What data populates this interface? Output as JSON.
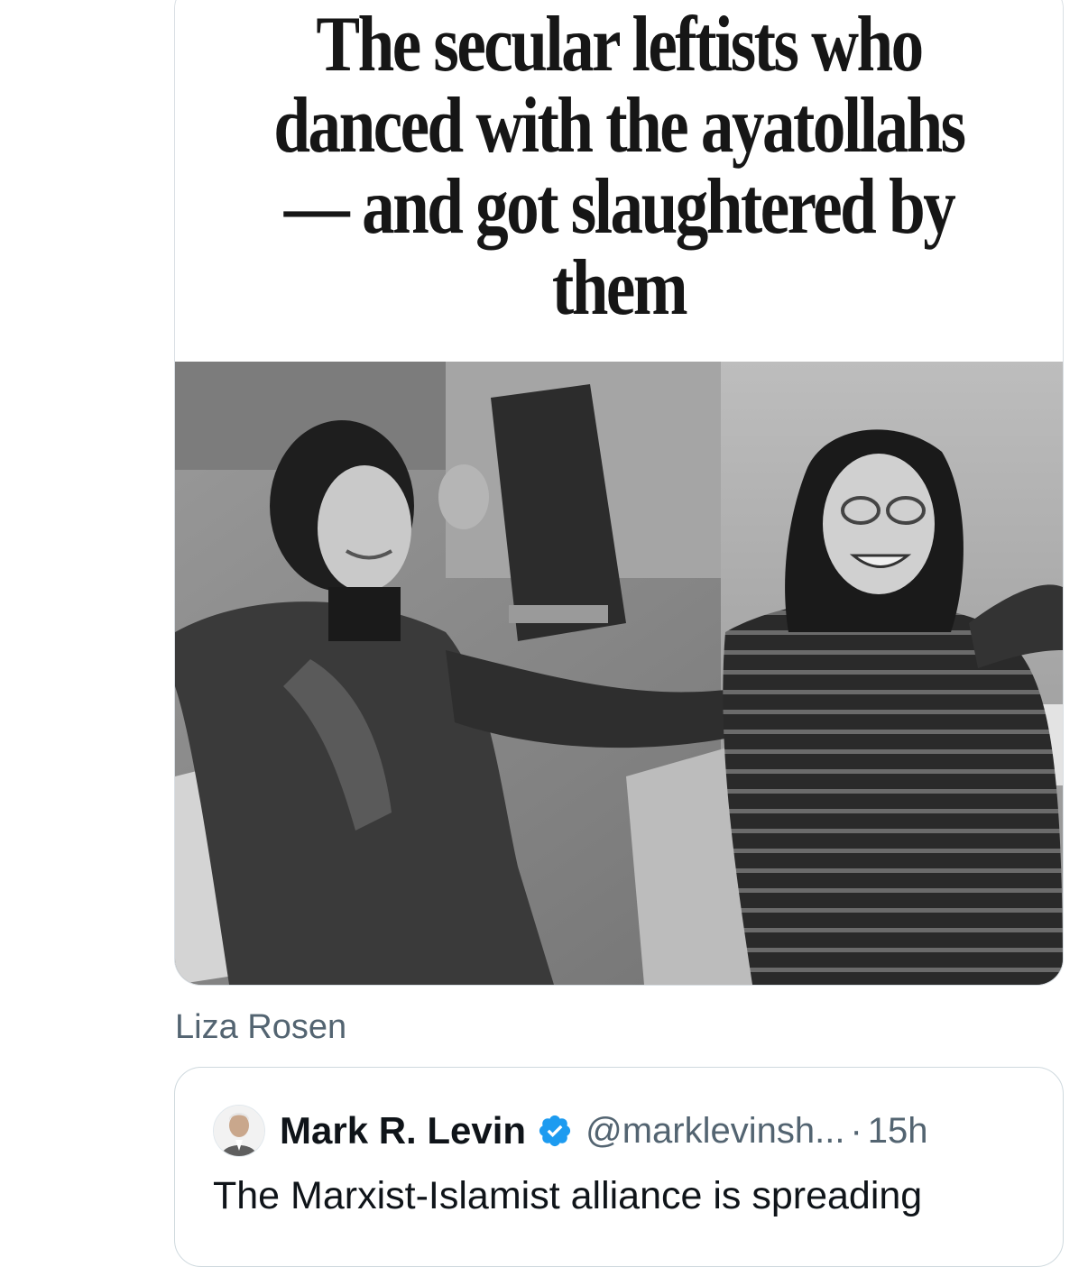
{
  "media": {
    "headline": "The secular leftists who danced with the ayatollahs — and got slaughtered by them"
  },
  "caption": "Liza Rosen",
  "quote": {
    "name": "Mark R. Levin",
    "handle": "@marklevinsh...",
    "separator": "·",
    "time": "15h",
    "text": "The Marxist-Islamist alliance is spreading"
  },
  "colors": {
    "verified_badge": "#1d9bf0",
    "secondary_text": "#536471",
    "primary_text": "#0f1419",
    "border": "#cfd9de"
  },
  "icons": {
    "verified": "verified-badge-icon"
  }
}
